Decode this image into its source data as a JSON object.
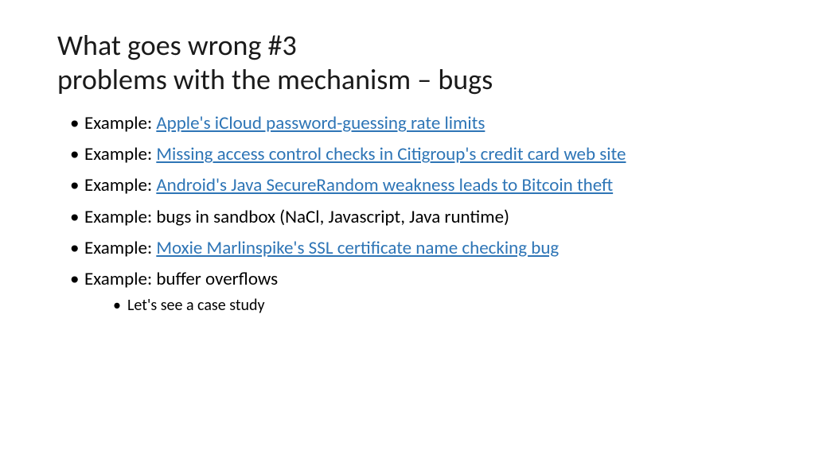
{
  "title_line1": "What goes wrong #3",
  "title_line2": "problems with the mechanism – bugs",
  "bullets": [
    {
      "prefix": "Example: ",
      "link": "Apple's iCloud password-guessing rate limits",
      "text": ""
    },
    {
      "prefix": "Example: ",
      "link": "Missing access control checks in Citigroup's credit card web site",
      "text": ""
    },
    {
      "prefix": "Example: ",
      "link": "Android's Java SecureRandom weakness leads to Bitcoin theft",
      "text": ""
    },
    {
      "prefix": "Example: ",
      "link": "",
      "text": "bugs in sandbox (NaCl, Javascript, Java runtime)"
    },
    {
      "prefix": "Example: ",
      "link": "Moxie Marlinspike's SSL certificate name checking bug",
      "text": ""
    },
    {
      "prefix": "Example: ",
      "link": "",
      "text": "buffer overflows",
      "sub": [
        "Let's see a case study"
      ]
    }
  ]
}
